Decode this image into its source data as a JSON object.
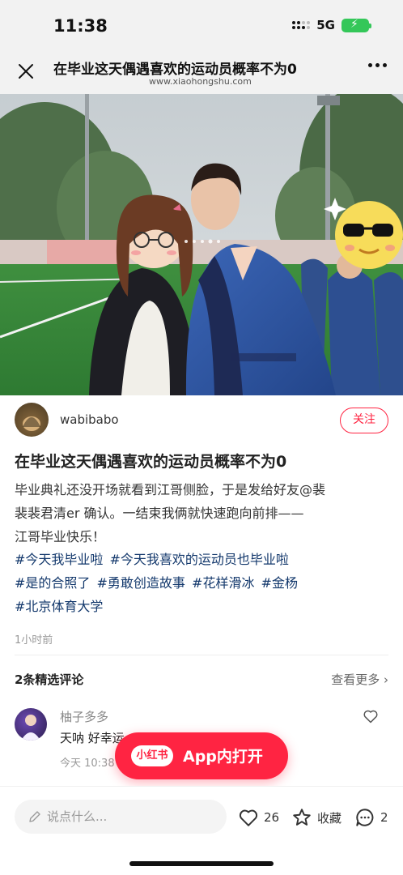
{
  "status": {
    "time": "11:38",
    "network": "5G"
  },
  "nav": {
    "title": "在毕业这天偶遇喜欢的运动员概率不为0",
    "url": "www.xiaohongshu.com"
  },
  "author": {
    "name": "wabibabo",
    "follow_label": "关注"
  },
  "post": {
    "title": "在毕业这天偶遇喜欢的运动员概率不为0",
    "body_lines": [
      "毕业典礼还没开场就看到江哥侧脸，于是发给好友@裴",
      "裴裴君清er 确认。一结束我俩就快速跑向前排——",
      "江哥毕业快乐！"
    ],
    "tag_lines": [
      [
        "#今天我毕业啦",
        "#今天我喜欢的运动员也毕业啦"
      ],
      [
        "#是的合照了",
        "#勇敢创造故事",
        "#花样滑冰",
        "#金杨"
      ],
      [
        "#北京体育大学"
      ]
    ],
    "time": "1小时前"
  },
  "comments": {
    "count_label": "2条精选评论",
    "more_label": "查看更多",
    "items": [
      {
        "user": "柚子多多",
        "text": "天呐 好幸运",
        "time": "今天 10:38"
      }
    ]
  },
  "open_app": {
    "badge": "小红书",
    "label": "App内打开"
  },
  "bottom": {
    "placeholder": "说点什么...",
    "likes": "26",
    "collect_label": "收藏",
    "comments": "2"
  },
  "colors": {
    "brand": "#ff2442",
    "tag": "#13386c"
  }
}
